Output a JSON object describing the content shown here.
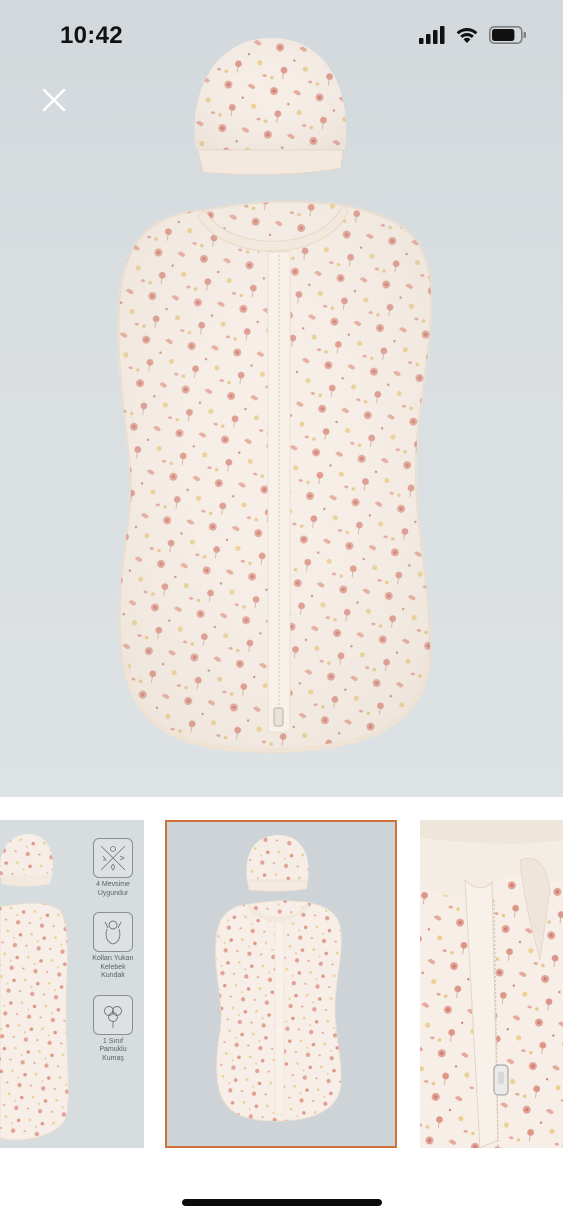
{
  "status_bar": {
    "time": "10:42",
    "battery_level": 0.8
  },
  "icons": {
    "close": "close-icon",
    "signal": "cellular-signal-icon",
    "wifi": "wifi-icon",
    "battery": "battery-icon",
    "seasons": "four-seasons-icon",
    "swaddle": "swaddle-baby-icon",
    "cotton": "cotton-flower-icon"
  },
  "colors": {
    "selected_thumb_border": "#d0733b",
    "fabric": "#f6eee6",
    "flower_pink": "#e2a095",
    "flower_yellow": "#e7cf8f"
  },
  "thumbnails": {
    "selected_index": 1,
    "features": [
      {
        "label": "4 Mevsime\nUygundur"
      },
      {
        "label": "Kolları Yukarı\nKelebek\nKundak"
      },
      {
        "label": "1 Sınıf\nPamuklu\nKumaş"
      }
    ]
  }
}
